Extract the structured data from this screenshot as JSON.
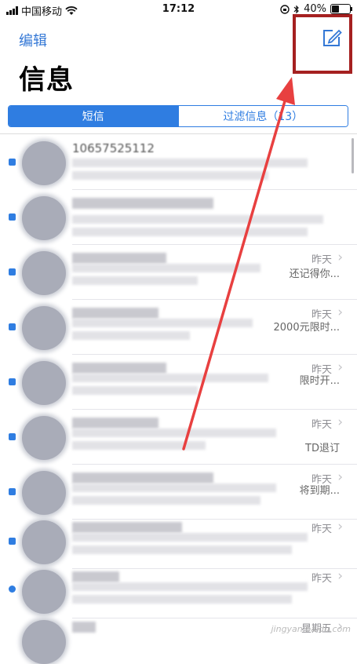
{
  "status_bar": {
    "carrier": "中国移动",
    "time": "17:12",
    "battery": "40%",
    "battery_level": 0.4
  },
  "nav": {
    "edit_label": "编辑",
    "title": "信息"
  },
  "tabs": [
    {
      "label": "短信"
    },
    {
      "label": "过滤信息（13）"
    }
  ],
  "messages": [
    {
      "sender": "10657525112",
      "date": "",
      "preview_tail": ""
    },
    {
      "sender": "",
      "date": "",
      "preview_tail": ""
    },
    {
      "sender": "",
      "date": "昨天",
      "preview_tail": "还记得你..."
    },
    {
      "sender": "",
      "date": "昨天",
      "preview_tail": "2000元限时..."
    },
    {
      "sender": "",
      "date": "昨天",
      "preview_tail": "限时开..."
    },
    {
      "sender": "",
      "date": "昨天",
      "preview_tail": "TD退订"
    },
    {
      "sender": "",
      "date": "昨天",
      "preview_tail": "将到期..."
    },
    {
      "sender": "",
      "date": "昨天",
      "preview_tail": ""
    },
    {
      "sender": "",
      "date": "昨天",
      "preview_tail": ""
    },
    {
      "sender": "",
      "date": "星期五",
      "preview_tail": ""
    }
  ],
  "watermark": "jingyan.baidu.com",
  "colors": {
    "accent": "#2f7de1",
    "highlight": "#a52020",
    "arrow": "#e84040"
  }
}
